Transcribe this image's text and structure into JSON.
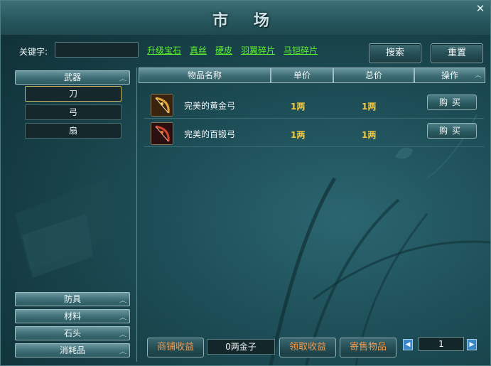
{
  "window": {
    "title": "市 场",
    "close_glyph": "✕"
  },
  "search": {
    "keyword_label": "关键字:",
    "keyword_value": "",
    "search_button": "搜索",
    "reset_button": "重置",
    "quick_links": [
      "升级宝石",
      "真丝",
      "硬皮",
      "羽翼碎片",
      "马铠碎片"
    ]
  },
  "categories": {
    "weapons": {
      "label": "武器",
      "subitems": [
        "刀",
        "弓",
        "扇"
      ],
      "selected": "刀"
    },
    "others": [
      "防具",
      "材料",
      "石头",
      "消耗品"
    ]
  },
  "table": {
    "headers": [
      "物品名称",
      "单价",
      "总价",
      "操作"
    ],
    "rows": [
      {
        "icon": "golden-bow-icon",
        "name": "完美的黄金弓",
        "unit_price": "1两",
        "total_price": "1两",
        "action": "购买"
      },
      {
        "icon": "forged-bow-icon",
        "name": "完美的百锻弓",
        "unit_price": "1两",
        "total_price": "1两",
        "action": "购买"
      }
    ]
  },
  "bottom": {
    "shop_income_button": "商铺收益",
    "gold_amount": "0两金子",
    "collect_income_button": "领取收益",
    "consign_button": "寄售物品",
    "page": "1",
    "prev_glyph": "◀",
    "next_glyph": "▶"
  },
  "colors": {
    "link_green": "#5cf22b",
    "price_gold": "#f6c93b",
    "bottom_button_text": "#f39a4c"
  }
}
